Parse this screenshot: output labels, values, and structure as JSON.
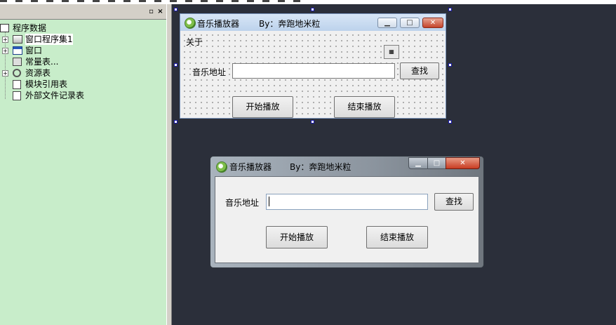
{
  "tree": {
    "root": "程序数据",
    "items": [
      "窗口程序集1",
      "窗口",
      "常量表...",
      "资源表",
      "模块引用表",
      "外部文件记录表"
    ]
  },
  "panel": {
    "pin_glyph": "▫",
    "close_glyph": "×"
  },
  "design_form": {
    "title": "音乐播放器",
    "author": "By：奔跑地米粒",
    "menu_about": "关于",
    "address_label": "音乐地址",
    "address_value": "",
    "find_button": "查找",
    "start_button": "开始播放",
    "stop_button": "结束播放"
  },
  "runtime_form": {
    "title": "音乐播放器",
    "author": "By：奔跑地米粒",
    "address_label": "音乐地址",
    "address_value": "",
    "find_button": "查找",
    "start_button": "开始播放",
    "stop_button": "结束播放"
  },
  "colors": {
    "tree_bg": "#c8edca",
    "workspace_bg": "#2b2f3a",
    "form_bg": "#f0f0f0"
  }
}
